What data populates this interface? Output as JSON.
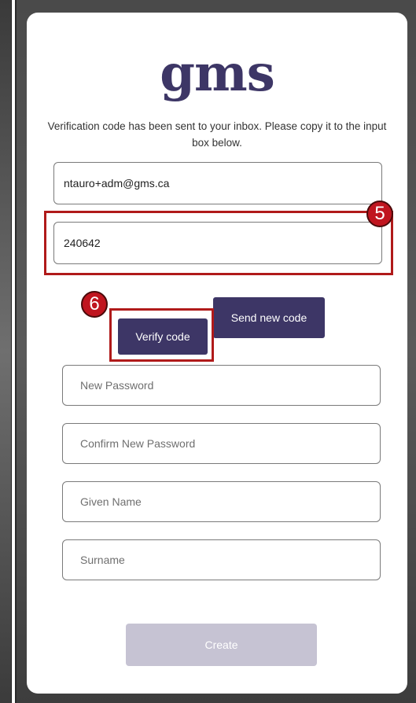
{
  "brand": {
    "logo_text": "gms",
    "logo_color": "#3d3666"
  },
  "info_text": "Verification code has been sent to your inbox. Please copy it to the input box below.",
  "email_field": {
    "value": "ntauro+adm@gms.ca"
  },
  "code_field": {
    "value": "240642"
  },
  "buttons": {
    "verify": "Verify code",
    "send_new": "Send new code",
    "create": "Create"
  },
  "fields": {
    "new_password": {
      "placeholder": "New Password"
    },
    "confirm_password": {
      "placeholder": "Confirm New Password"
    },
    "given_name": {
      "placeholder": "Given Name"
    },
    "surname": {
      "placeholder": "Surname"
    }
  },
  "annotations": {
    "step5": "5",
    "step6": "6",
    "highlight_color": "#b01a1a"
  },
  "colors": {
    "primary": "#3d3666",
    "disabled": "#c6c3d3"
  }
}
